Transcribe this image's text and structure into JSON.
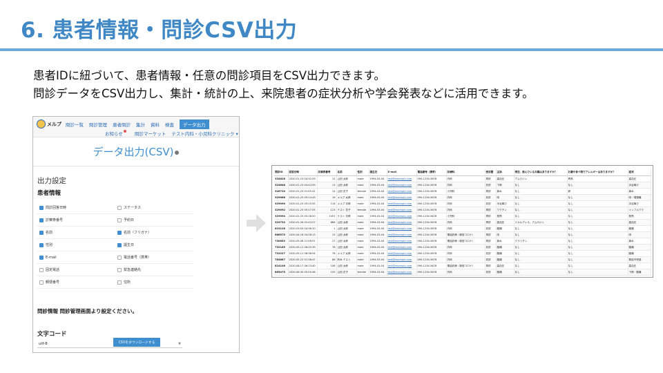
{
  "slide": {
    "title": "6. 患者情報・問診CSV出力",
    "desc1": "患者IDに紐づいて、患者情報・任意の問診項目をCSV出力できます。",
    "desc2": "問診データをCSV出力し、集計・統計の上、来院患者の症状分析や学会発表などに活用できます。"
  },
  "app": {
    "logo_text": "メルプ",
    "nav": [
      "問診一覧",
      "問診管理",
      "患者問診",
      "集計",
      "資料",
      "検査"
    ],
    "nav_active": "データ出力",
    "nav2": [
      "お知らせ",
      "問診マーケット",
      "テスト内科・小児科クリニック ▾"
    ],
    "page_title": "データ出力(CSV)",
    "section_title": "出力設定",
    "patient_info_label": "患者情報",
    "checkboxes": [
      {
        "label": "問診回答日時",
        "checked": true
      },
      {
        "label": "ステータス",
        "checked": false
      },
      {
        "label": "診察券番号",
        "checked": true
      },
      {
        "label": "予約日",
        "checked": false
      },
      {
        "label": "名前",
        "checked": true
      },
      {
        "label": "名前（フリガナ）",
        "checked": true
      },
      {
        "label": "性別",
        "checked": true
      },
      {
        "label": "誕生日",
        "checked": true
      },
      {
        "label": "E-mail",
        "checked": true
      },
      {
        "label": "電話番号（携帯）",
        "checked": false
      },
      {
        "label": "固定電話",
        "checked": false
      },
      {
        "label": "緊急連絡先",
        "checked": false
      },
      {
        "label": "郵便番号",
        "checked": false
      },
      {
        "label": "住所",
        "checked": false
      }
    ],
    "note": "問診情報 問診管理画面より設定ください。",
    "encoding_label": "文字コード",
    "encoding_value": "utf-8",
    "download_button": "CSVをダウンロードする"
  },
  "csv": {
    "headers": [
      "問診ID",
      "回答日時",
      "診察券番号",
      "名前",
      "性別",
      "誕生日",
      "E-mail",
      "電話番号（携帯）",
      "診療科",
      "受診歴",
      "主訴",
      "現在、飲んでいるお薬はありますか？",
      "お薬や食べ物でアレルギーはありますか？",
      "症状"
    ],
    "rows": [
      [
        "334628",
        "2020-01-23 04:32:09",
        "12",
        "山田 太郎",
        "male",
        "1994-03-04",
        "test@example.com",
        "090-1234-5678",
        "内科",
        "再診",
        "高血圧",
        "アムロジン",
        "青魚",
        "高血圧"
      ],
      [
        "324648",
        "2020-01-23 04:43:59",
        "13",
        "山田 太郎",
        "male",
        "1994-03-04",
        "test@example.com",
        "090-1234-5678",
        "内科",
        "初診",
        "下痢",
        "なし",
        "なし",
        "手足痺び"
      ],
      [
        "326720",
        "2020-01-25 01:55:41",
        "14",
        "山田 花子",
        "female",
        "1994-03-04",
        "test@example.com",
        "090-1234-5678",
        "小児科",
        "再診",
        "鼻水",
        "なし",
        "卵",
        "鼻水"
      ],
      [
        "329068",
        "2020-01-25 05:14:43",
        "16",
        "メルプ 太郎",
        "male",
        "1994-03-04",
        "test@example.com",
        "090-1234-5678",
        "内科",
        "初診",
        "咳",
        "なし",
        "なし",
        "咳・咽頭痛"
      ],
      [
        "329090",
        "2020-01-25 05:15:55",
        "116",
        "メルプ 次郎",
        "male",
        "1994-03-04",
        "test@example.com",
        "090-1234-5678",
        "内科",
        "初診",
        "手足痺び",
        "なし",
        "なし",
        "手足痺び"
      ],
      [
        "329092",
        "2020-01-25 05:17:05",
        "123",
        "テスト 花子",
        "female",
        "1994-03-04",
        "test@example.com",
        "090-1234-5678",
        "内科",
        "再診",
        "ワクチン",
        "なし",
        "なし",
        "インフルワク"
      ],
      [
        "329094",
        "2020-01-25 05:18:20",
        "1451",
        "テスト 次郎",
        "male",
        "1994-03-04",
        "test@example.com",
        "090-1234-5678",
        "小児科",
        "再診",
        "発熱",
        "なし",
        "なし",
        "発熱"
      ],
      [
        "329732",
        "2020-01-26 02:43:27",
        "684",
        "山田 太郎",
        "male",
        "1994-03-04",
        "test@example.com",
        "090-1234-5678",
        "内科",
        "再診",
        "高血圧",
        "ミカルディス、アムロジン",
        "なし",
        "高血圧"
      ],
      [
        "619128",
        "2020-03-04 04:36:10",
        "1",
        "山田 太郎",
        "male",
        "1994-03-04",
        "test@example.com",
        "090-1234-5678",
        "内科",
        "初診",
        "腹痛",
        "なし",
        "なし",
        "腹痛"
      ],
      [
        "666575",
        "2020-04-16 04:28:13",
        "15",
        "山田 太郎",
        "male",
        "1994-03-04",
        "test@example.com",
        "090-1234-5678",
        "電話診療（新型コロナ）",
        "再診",
        "咳",
        "なし",
        "なし",
        "咳"
      ],
      [
        "730653",
        "2020-05-08 21:56:51",
        "27",
        "山田 太郎",
        "male",
        "1994-03-04",
        "test@example.com",
        "090-1234-5678",
        "電話診療（新型コロナ）",
        "再診",
        "鼻水",
        "クラリチン",
        "なし",
        "鼻水"
      ],
      [
        "732165",
        "2020-05-11 08:25:39",
        "78",
        "山田 太郎",
        "male",
        "1994-03-04",
        "test@example.com",
        "090-1234-5678",
        "内科",
        "初診",
        "腹痛",
        "なし",
        "なし",
        "腹痛"
      ],
      [
        "732227",
        "2020-05-11 08:38:54",
        "78",
        "メルプ 太郎",
        "male",
        "1994-03-04",
        "test@example.com",
        "090-1234-5678",
        "内科",
        "初診",
        "腹痛",
        "なし",
        "なし",
        "腹痛"
      ],
      [
        "784887",
        "2020-05-22 01:38:47",
        "86",
        "鈴木 テスト",
        "male",
        "1994-03-04",
        "test@example.com",
        "090-1234-5678",
        "内科",
        "初診",
        "腹痛",
        "なし",
        "なし",
        "発症不快感"
      ],
      [
        "824106",
        "2020-06-17 06:13:40",
        "108",
        "山田 太郎",
        "male",
        "1994-03-04",
        "test@example.com",
        "090-1234-5678",
        "電話診療（新型コロナ）",
        "再診",
        "高血圧",
        "なし",
        "なし",
        "高血圧"
      ],
      [
        "865475",
        "2020-06-30 05:05:46",
        "155",
        "山田 花子",
        "female",
        "1994-03-04",
        "test@example.com",
        "090-1234-5678",
        "内科",
        "初診",
        "腹痛",
        "なし",
        "なし",
        "下痢・腹痛"
      ]
    ]
  }
}
